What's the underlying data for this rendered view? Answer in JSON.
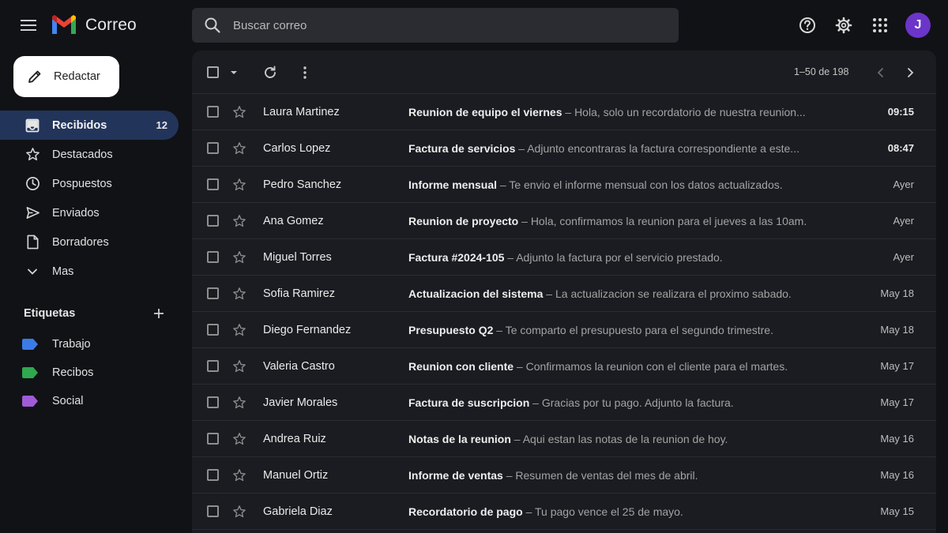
{
  "app": {
    "title": "Correo"
  },
  "search": {
    "placeholder": "Buscar correo"
  },
  "header": {
    "help_icon": "help-icon",
    "settings_icon": "gear-icon",
    "apps_icon": "apps-grid-icon",
    "avatar_initial": "J",
    "avatar_color": "#6b35c9"
  },
  "compose": {
    "label": "Redactar"
  },
  "nav": [
    {
      "label": "Recibidos",
      "icon": "inbox-icon",
      "count": "12",
      "active": true
    },
    {
      "label": "Destacados",
      "icon": "star-icon",
      "count": ""
    },
    {
      "label": "Pospuestos",
      "icon": "clock-icon",
      "count": ""
    },
    {
      "label": "Enviados",
      "icon": "send-icon",
      "count": ""
    },
    {
      "label": "Borradores",
      "icon": "draft-icon",
      "count": ""
    },
    {
      "label": "Mas",
      "icon": "chevron-down-icon",
      "count": ""
    }
  ],
  "labels": {
    "title": "Etiquetas",
    "items": [
      {
        "name": "Trabajo",
        "color": "#3b7be8"
      },
      {
        "name": "Recibos",
        "color": "#2fa84f"
      },
      {
        "name": "Social",
        "color": "#a05bd6"
      }
    ]
  },
  "toolbar": {
    "pager": "1–50 de 198"
  },
  "emails": [
    {
      "sender": "Laura Martinez",
      "subject": "Reunion de equipo el viernes",
      "snippet": "Hola, solo un recordatorio de nuestra reunion...",
      "date": "09:15",
      "unread": true
    },
    {
      "sender": "Carlos Lopez",
      "subject": "Factura de servicios",
      "snippet": "Adjunto encontraras la factura correspondiente a este...",
      "date": "08:47",
      "unread": true
    },
    {
      "sender": "Pedro Sanchez",
      "subject": "Informe mensual",
      "snippet": "Te envio el informe mensual con los datos actualizados.",
      "date": "Ayer",
      "unread": false
    },
    {
      "sender": "Ana Gomez",
      "subject": "Reunion de proyecto",
      "snippet": "Hola, confirmamos la reunion para el jueves a las 10am.",
      "date": "Ayer",
      "unread": false
    },
    {
      "sender": "Miguel Torres",
      "subject": "Factura #2024-105",
      "snippet": "Adjunto la factura por el servicio prestado.",
      "date": "Ayer",
      "unread": false
    },
    {
      "sender": "Sofia Ramirez",
      "subject": "Actualizacion del sistema",
      "snippet": "La actualizacion se realizara el proximo sabado.",
      "date": "May 18",
      "unread": false
    },
    {
      "sender": "Diego Fernandez",
      "subject": "Presupuesto Q2",
      "snippet": "Te comparto el presupuesto para el segundo trimestre.",
      "date": "May 18",
      "unread": false
    },
    {
      "sender": "Valeria Castro",
      "subject": "Reunion con cliente",
      "snippet": "Confirmamos la reunion con el cliente para el martes.",
      "date": "May 17",
      "unread": false
    },
    {
      "sender": "Javier Morales",
      "subject": "Factura de suscripcion",
      "snippet": "Gracias por tu pago. Adjunto la factura.",
      "date": "May 17",
      "unread": false
    },
    {
      "sender": "Andrea Ruiz",
      "subject": "Notas de la reunion",
      "snippet": "Aqui estan las notas de la reunion de hoy.",
      "date": "May 16",
      "unread": false
    },
    {
      "sender": "Manuel Ortiz",
      "subject": "Informe de ventas",
      "snippet": "Resumen de ventas del mes de abril.",
      "date": "May 16",
      "unread": false
    },
    {
      "sender": "Gabriela Diaz",
      "subject": "Recordatorio de pago",
      "snippet": "Tu pago vence el 25 de mayo.",
      "date": "May 15",
      "unread": false
    }
  ]
}
